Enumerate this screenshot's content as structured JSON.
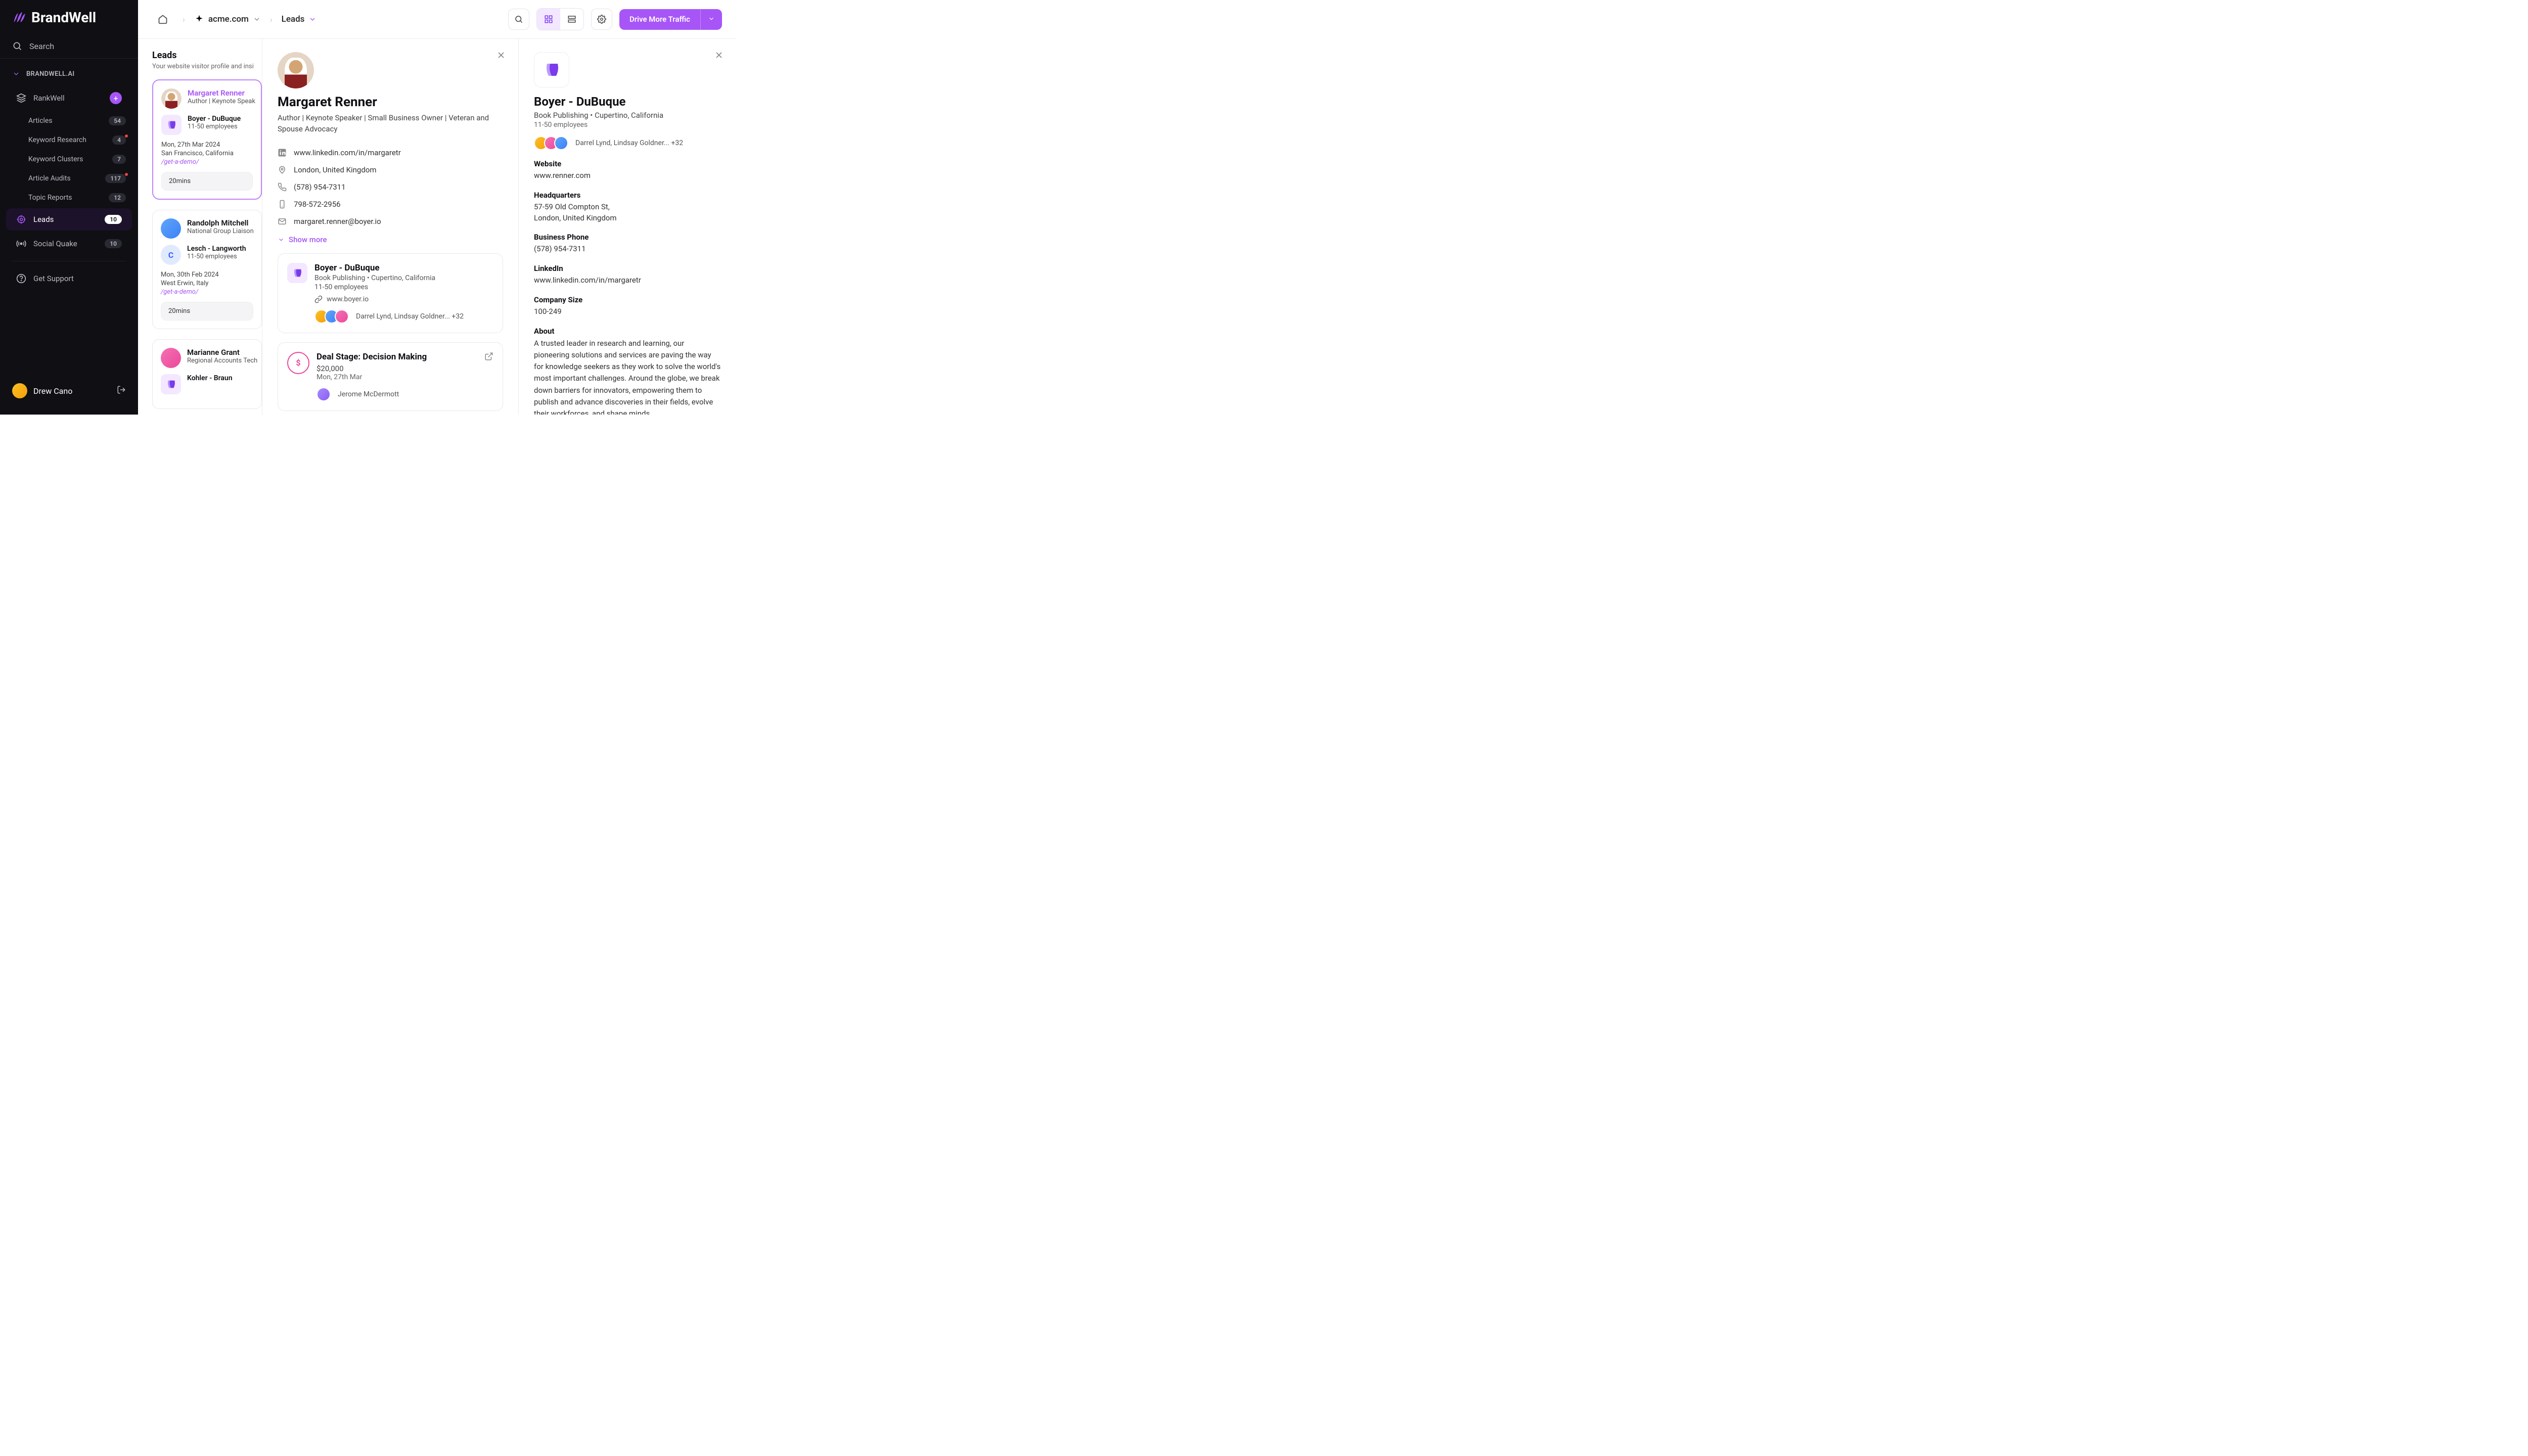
{
  "brand": "BrandWell",
  "sidebar": {
    "search": "Search",
    "workspace": "BRANDWELL.AI",
    "rankwell": "RankWell",
    "items": [
      {
        "label": "Articles",
        "badge": "54"
      },
      {
        "label": "Keyword Research",
        "badge": "4",
        "dot": true
      },
      {
        "label": "Keyword Clusters",
        "badge": "7"
      },
      {
        "label": "Article Audits",
        "badge": "117",
        "dot": true
      },
      {
        "label": "Topic Reports",
        "badge": "12"
      }
    ],
    "leads": {
      "label": "Leads",
      "badge": "10"
    },
    "social": {
      "label": "Social Quake",
      "badge": "10"
    },
    "support": "Get Support",
    "user": "Drew Cano"
  },
  "breadcrumb": {
    "site": "acme.com",
    "page": "Leads"
  },
  "cta": "Drive More Traffic",
  "leads": {
    "title": "Leads",
    "subtitle": "Your website visitor profile and insi",
    "cards": [
      {
        "name": "Margaret Renner",
        "title": "Author | Keynote Speak",
        "company": "Boyer - DuBuque",
        "size": "11-50 employees",
        "date": "Mon, 27th Mar 2024",
        "loc": "San Francisco, California",
        "path": "/get-a-demo/",
        "duration": "20mins",
        "selected": true,
        "avatar": "photo",
        "ctype": "logo"
      },
      {
        "name": "Randolph Mitchell",
        "title": "National Group Liaison",
        "company": "Lesch - Langworth",
        "size": "11-50 employees",
        "date": "Mon, 30th Feb 2024",
        "loc": "West Erwin, Italy",
        "path": "/get-a-demo/",
        "duration": "20mins",
        "avatar": "av-b",
        "ctype": "letter"
      },
      {
        "name": "Marianne Grant",
        "title": "Regional Accounts Tech",
        "company": "Kohler - Braun",
        "avatar": "av-c"
      }
    ]
  },
  "person": {
    "name": "Margaret Renner",
    "title": "Author | Keynote Speaker | Small Business Owner | Veteran and Spouse Advocacy",
    "linkedin": "www.linkedin.com/in/margaretr",
    "location": "London, United Kingdom",
    "phone": "(578) 954-7311",
    "mobile": "798-572-2956",
    "email": "margaret.renner@boyer.io",
    "showMore": "Show more",
    "company": {
      "name": "Boyer - DuBuque",
      "sub": "Book Publishing • Cupertino, California",
      "size": "11-50 employees",
      "url": "www.boyer.io",
      "people": "Darrel Lynd, Lindsay Goldner... +32"
    },
    "deal": {
      "stage": "Deal Stage: Decision Making",
      "amount": "$20,000",
      "date": "Mon, 27th Mar",
      "owner": "Jerome McDermott"
    }
  },
  "company": {
    "name": "Boyer - DuBuque",
    "sub": "Book Publishing • Cupertino, California",
    "size": "11-50 employees",
    "people": "Darrel Lynd, Lindsay Goldner... +32",
    "fields": {
      "websiteL": "Website",
      "website": "www.renner.com",
      "hqL": "Headquarters",
      "hq": "57-59 Old Compton St,\nLondon, United Kingdom",
      "phoneL": "Business Phone",
      "phone": "(578) 954-7311",
      "liL": "LinkedIn",
      "li": "www.linkedin.com/in/margaretr",
      "sizeL": "Company Size",
      "sizeV": "100-249",
      "aboutL": "About",
      "about": "A trusted leader in research and learning, our pioneering solutions and services are paving the way for knowledge seekers as they work to solve the world's most important challenges. Around the globe, we break down barriers for innovators, empowering them to publish and advance discoveries in their fields, evolve their workforces, and shape minds"
    }
  }
}
